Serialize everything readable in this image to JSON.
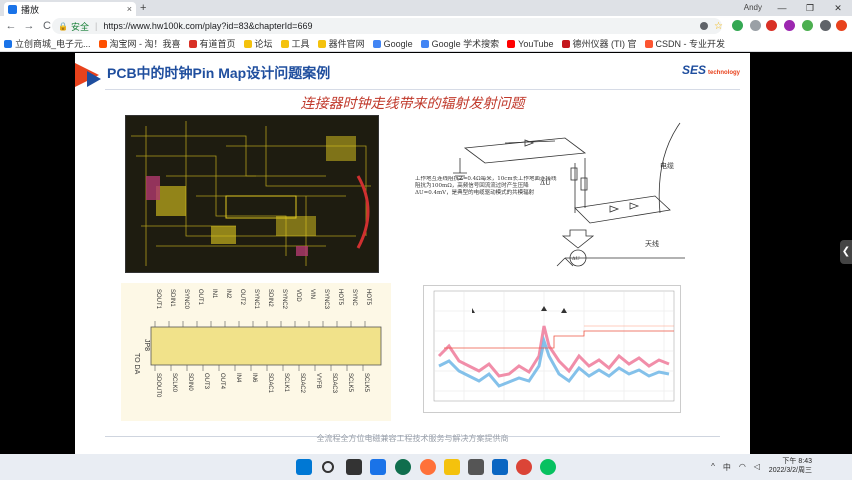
{
  "browser": {
    "tab_title": "播放",
    "tab_close": "×",
    "new_tab": "+",
    "user": "Andy",
    "window_controls": [
      "—",
      "❐",
      "✕"
    ],
    "nav": {
      "back": "←",
      "forward": "→",
      "reload": "C"
    },
    "security_label": "安全",
    "url": "https://www.hw100k.com/play?id=83&chapterId=669",
    "bookmarks": [
      {
        "label": "立创商城_电子元...",
        "color": "#1a73e8"
      },
      {
        "label": "淘宝网 - 淘！我喜",
        "color": "#ff5000"
      },
      {
        "label": "有道首页",
        "color": "#d93025"
      },
      {
        "label": "论坛",
        "color": "#f4c20d"
      },
      {
        "label": "工具",
        "color": "#f4c20d"
      },
      {
        "label": "器件官网",
        "color": "#f4c20d"
      },
      {
        "label": "Google",
        "color": "#4285f4"
      },
      {
        "label": "Google 学术搜索",
        "color": "#4285f4"
      },
      {
        "label": "YouTube",
        "color": "#ff0000"
      },
      {
        "label": "德州仪器 (TI) 官",
        "color": "#c4161c"
      },
      {
        "label": "CSDN - 专业开发",
        "color": "#fc5531"
      }
    ]
  },
  "slide": {
    "title": "PCB中的时钟Pin Map设计问题案例",
    "logo": "SES",
    "logo_sub": "technology",
    "subtitle": "连接器时钟走线带来的辐射发射问题",
    "diagram": {
      "text": "工作地互连线阻抗Z=0.4Ω每米，10cm长工作地面连接线阻抗为100mΩ，高频信号回流流过时产生压降ΔU=0.4mV，是典型的电缆驱动模式的共模辐射",
      "labels": {
        "cable": "电缆",
        "antenna": "天线",
        "delta_u": "ΔU"
      }
    },
    "pinmap": {
      "header": "JP8",
      "side_label": "TO DA",
      "top_labels": [
        "SOUT1",
        "SDIN1",
        "SYNC0",
        "OUT1",
        "IN1",
        "IN2",
        "OUT2",
        "SYNC1",
        "SDIN2",
        "SYNC2",
        "VDD",
        "VIN",
        "SYNC3",
        "HOT5",
        "SYNC",
        "HOT5"
      ],
      "bottom_labels": [
        "SDOUT0",
        "SCLK0",
        "SDIN0",
        "OUT3",
        "OUT4",
        "IN4",
        "IN6",
        "SDAC1",
        "SCLK1",
        "SDAC2",
        "VYFB",
        "SDAC3",
        "SCLK5",
        "SCLK5"
      ]
    },
    "footer": "全流程全方位电磁兼容工程技术服务与解决方案提供商"
  },
  "taskbar": {
    "tray_ime": "中",
    "time": "下午 8:43",
    "date": "2022/3/2/周三"
  }
}
